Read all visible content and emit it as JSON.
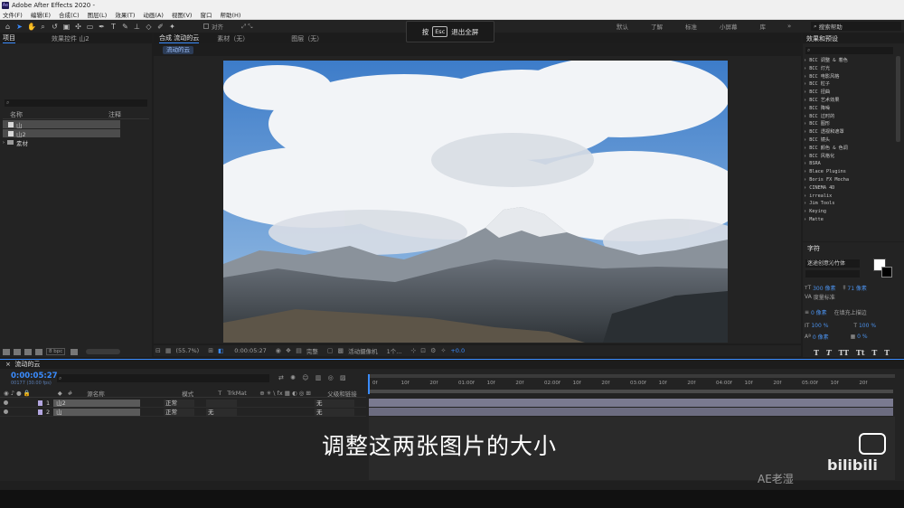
{
  "app_title": "Adobe After Effects 2020 -",
  "menu": [
    "文件(F)",
    "编辑(E)",
    "合成(C)",
    "图层(L)",
    "效果(T)",
    "动画(A)",
    "视图(V)",
    "窗口",
    "帮助(H)"
  ],
  "toolbar": {
    "align_label": "对齐"
  },
  "workspaces": [
    "默认",
    "了解",
    "标准",
    "小屏幕",
    "库"
  ],
  "help_search": "搜索帮助",
  "fullscreen_toast": {
    "press": "按",
    "key": "Esc",
    "action": "退出全屏"
  },
  "project": {
    "tab_project": "项目",
    "tab_effects": "效果控件 山2",
    "col_name": "名称",
    "col_note": "注释",
    "items": [
      "山",
      "山2",
      "素材"
    ],
    "bpc": "8 bpc"
  },
  "composition": {
    "tab_comp": "合成 流动的云",
    "tab_layer": "素材（无）",
    "tab_layer2": "图层（无）",
    "chip": "流动的云",
    "zoom": "(55.7%)",
    "timecode": "0:00:05:27",
    "quality": "完整",
    "camera": "活动摄像机",
    "views": "1个...",
    "offset": "+0.0"
  },
  "effects": {
    "tab": "效果和预设",
    "items": [
      "BCC 调整 & 着色",
      "BCC 灯光",
      "BCC 电影风格",
      "BCC 粒子",
      "BCC 扭曲",
      "BCC 艺术效果",
      "BCC 降噪",
      "BCC 过时的",
      "BCC 图形",
      "BCC 透视和遮罩",
      "BCC 镜头",
      "BCC 颜色 & 色调",
      "BCC 风格化",
      "BSRA",
      "Blace Plugins",
      "Boris FX Mocha",
      "CINEMA 4D",
      "irrealix",
      "Jim Tools",
      "Keying",
      "Matte"
    ]
  },
  "character": {
    "tab": "字符",
    "font": "迷途创意沁竹体",
    "size": "300 像素",
    "leading": "71 像素",
    "tracking_label": "度量标准",
    "stroke": "0 像素",
    "stroke_mode": "在填充上描边",
    "vscale": "100 %",
    "hscale": "100 %",
    "baseline": "0 像素",
    "tsume": "0 %",
    "styles": [
      "T",
      "T",
      "TT",
      "Tt",
      "T",
      "T"
    ]
  },
  "timeline": {
    "tab": "流动的云",
    "timecode": "0:00:05:27",
    "fps": "00177 (30.00 fps)",
    "cols": {
      "name": "源名称",
      "mode": "模式",
      "trkmat": "TrkMat",
      "parent": "父级和链接"
    },
    "layers": [
      {
        "num": "1",
        "name": "山2",
        "mode": "正常",
        "trkmat": "",
        "parent": "无"
      },
      {
        "num": "2",
        "name": "山",
        "mode": "正常",
        "trkmat": "无",
        "parent": "无"
      }
    ],
    "ruler": [
      "0f",
      "10f",
      "20f",
      "01:00f",
      "10f",
      "20f",
      "02:00f",
      "10f",
      "20f",
      "03:00f",
      "10f",
      "20f",
      "04:00f",
      "10f",
      "20f",
      "05:00f",
      "10f",
      "20f"
    ]
  },
  "subtitle": "调整这两张图片的大小",
  "watermark": "AE老湿",
  "logo": "bilibili"
}
